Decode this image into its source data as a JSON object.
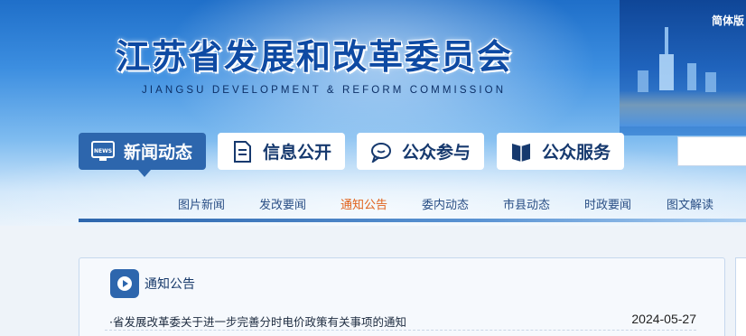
{
  "header": {
    "language_switch": "简体版",
    "site_title": "江苏省发展和改革委员会",
    "site_subtitle": "JIANGSU DEVELOPMENT & REFORM COMMISSION"
  },
  "main_nav": {
    "items": [
      {
        "label": "新闻动态",
        "icon": "news-icon",
        "active": true
      },
      {
        "label": "信息公开",
        "icon": "document-icon",
        "active": false
      },
      {
        "label": "公众参与",
        "icon": "chat-bubble-icon",
        "active": false
      },
      {
        "label": "公众服务",
        "icon": "book-icon",
        "active": false
      }
    ],
    "news_icon_text": "NEWS"
  },
  "sub_nav": {
    "items": [
      {
        "label": "图片新闻"
      },
      {
        "label": "发改要闻"
      },
      {
        "label": "通知公告",
        "current": true
      },
      {
        "label": "委内动态"
      },
      {
        "label": "市县动态"
      },
      {
        "label": "时政要闻"
      },
      {
        "label": "图文解读"
      }
    ]
  },
  "notice_panel": {
    "title": "通知公告",
    "items": [
      {
        "title": "·省发展改革委关于进一步完善分时电价政策有关事项的通知",
        "date": "2024-05-27"
      }
    ]
  },
  "colors": {
    "primary_blue": "#2d66ad",
    "title_blue": "#0e4aa3",
    "highlight_orange": "#e0611a"
  }
}
